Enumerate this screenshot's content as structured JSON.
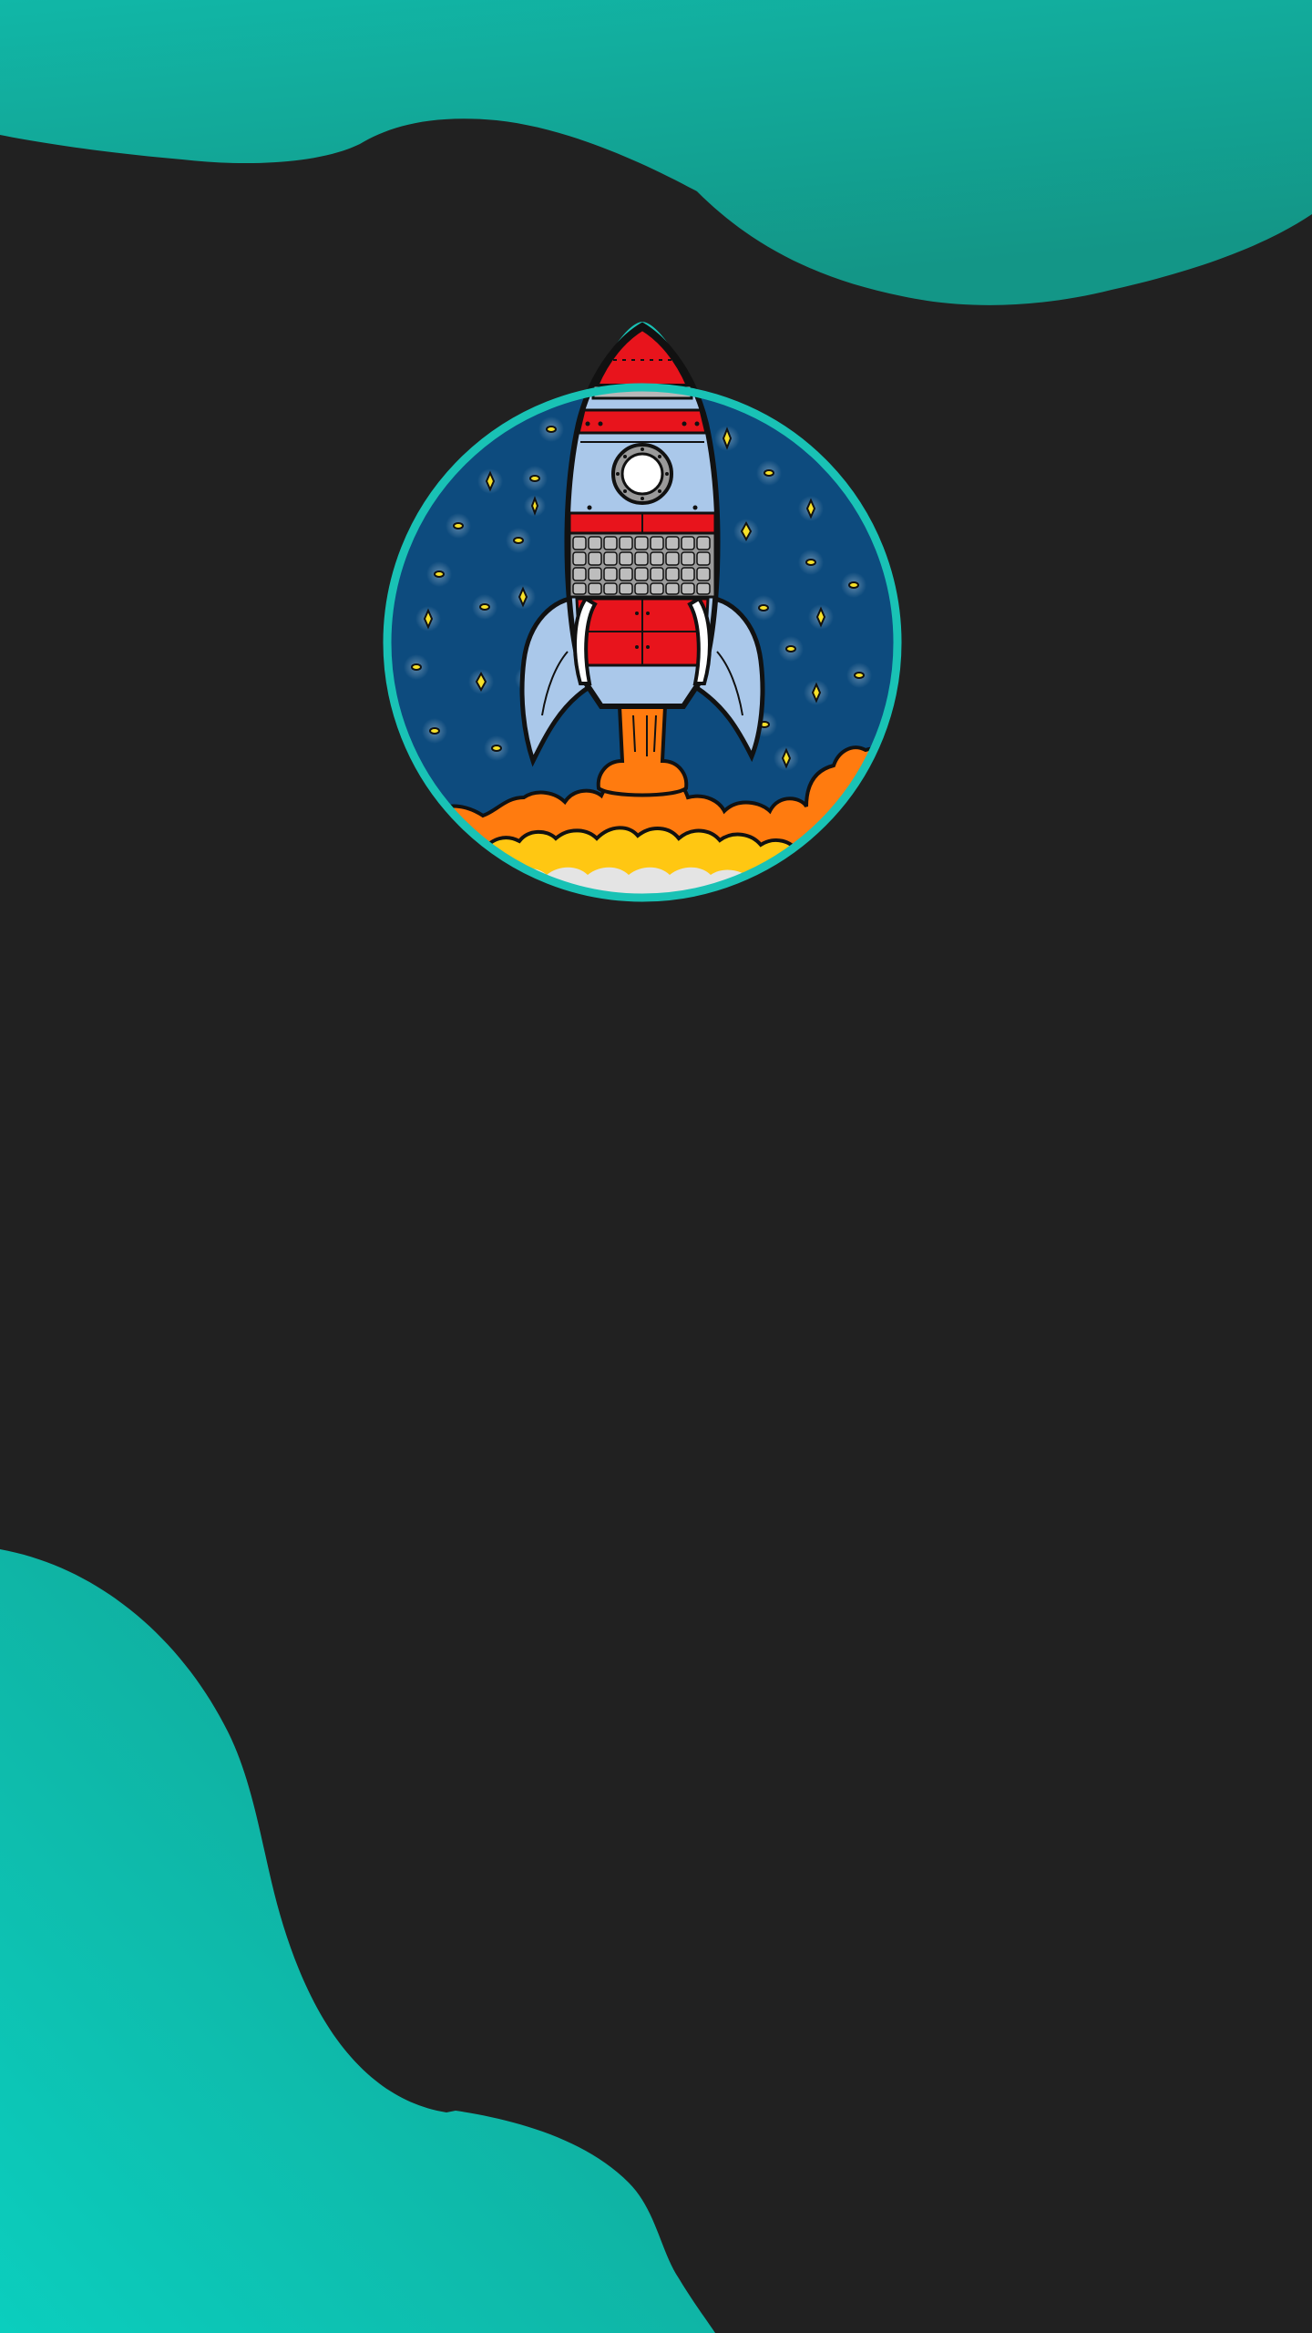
{
  "screen": {
    "name": "splash-screen",
    "background_color": "#212121"
  },
  "theme": {
    "accent_color": "#12b5a5",
    "accent_dark": "#129e8f",
    "accent_light": "#0dcdbd"
  },
  "logo": {
    "icon": "rocket-launch-icon",
    "ring_color": "#19c2b5",
    "sky_color": "#0d4b7e",
    "rocket_body_color": "#aac8ea",
    "rocket_stripe_color": "#e8141c",
    "flame_color": "#ff7b0f",
    "flame_inner_color": "#ffc712",
    "star_color": "#f7e12a"
  }
}
